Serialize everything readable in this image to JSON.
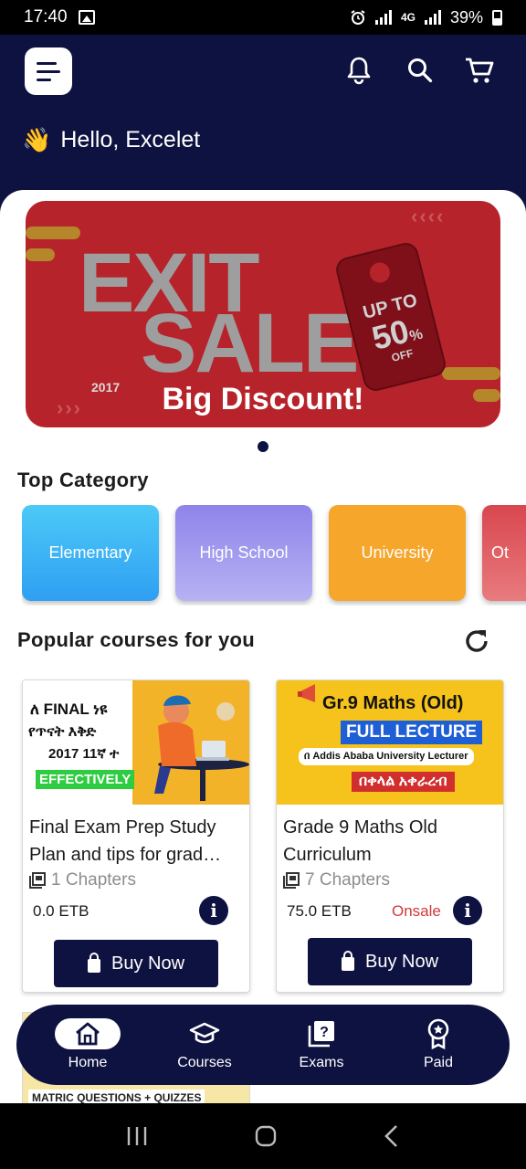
{
  "status_bar": {
    "time": "17:40",
    "network": "4G",
    "battery": "39%"
  },
  "header": {
    "greeting_emoji": "👋",
    "greeting": "Hello, Excelet"
  },
  "banner": {
    "line1": "EXIT",
    "line2": "SALE",
    "year": "2017",
    "tag_line1": "UP TO",
    "tag_value": "50",
    "tag_percent": "%",
    "tag_off": "OFF",
    "caption": "Big Discount!",
    "colors": {
      "background": "#b7232a",
      "accent": "#b5862a"
    }
  },
  "top_category": {
    "title": "Top Category",
    "items": [
      {
        "label": "Elementary"
      },
      {
        "label": "High School"
      },
      {
        "label": "University"
      },
      {
        "label": "Ot"
      }
    ]
  },
  "popular": {
    "title": "Popular courses for you",
    "courses": [
      {
        "title": "Final Exam Prep Study Plan and tips for grad…",
        "chapters": "1 Chapters",
        "price": "0.0 ETB",
        "onsale": "",
        "buy_label": "Buy Now",
        "thumb_line1": "ለ FINAL ነዩ",
        "thumb_line2": "የጥናት እቅድ",
        "thumb_line3": "2017 11ኛ ተ",
        "thumb_badge": "EFFECTIVELY"
      },
      {
        "title": "Grade 9 Maths Old Curriculum",
        "chapters": "7 Chapters",
        "price": "75.0 ETB",
        "onsale": "Onsale",
        "buy_label": "Buy Now",
        "thumb_line1": "Gr.9 Maths (Old)",
        "thumb_line2": "FULL LECTURE",
        "thumb_line3": "በ Addis Ababa University Lecturer",
        "thumb_line4": "በቀላል አቀራረብ"
      }
    ],
    "peek_text": "MATRIC QUESTIONS + QUIZZES"
  },
  "bottom_nav": {
    "items": [
      {
        "label": "Home",
        "icon": "home-icon"
      },
      {
        "label": "Courses",
        "icon": "graduation-cap-icon"
      },
      {
        "label": "Exams",
        "icon": "question-book-icon"
      },
      {
        "label": "Paid",
        "icon": "badge-icon"
      }
    ]
  },
  "theme": {
    "navy": "#0e1240",
    "onsale_red": "#d03a3a"
  }
}
